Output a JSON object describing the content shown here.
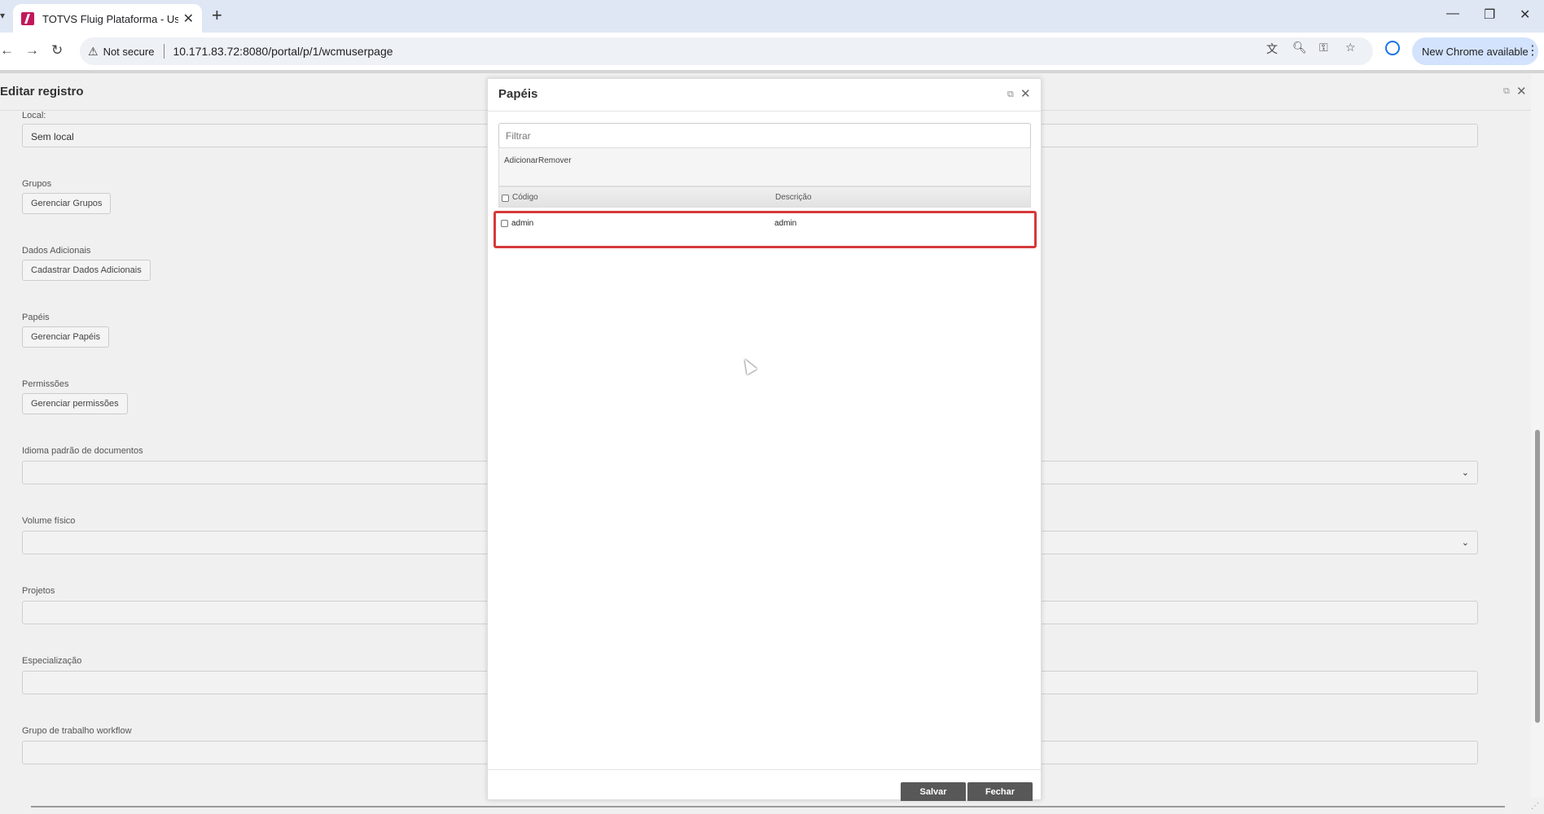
{
  "browser": {
    "tab_title": "TOTVS Fluig Plataforma - Usuár",
    "security_label": "Not secure",
    "url": "10.171.83.72:8080/portal/p/1/wcmuserpage",
    "update_label": "New Chrome available"
  },
  "page": {
    "title": "Editar registro",
    "fields": {
      "local_label": "Local:",
      "local_value": "Sem local",
      "grupos_label": "Grupos",
      "grupos_button": "Gerenciar Grupos",
      "dados_label": "Dados Adicionais",
      "dados_button": "Cadastrar Dados Adicionais",
      "papeis_label": "Papéis",
      "papeis_button": "Gerenciar Papéis",
      "permissoes_label": "Permissões",
      "permissoes_button": "Gerenciar permissões",
      "idioma_label": "Idioma padrão de documentos",
      "volume_label": "Volume físico",
      "projetos_label": "Projetos",
      "especializacao_label": "Especialização",
      "grupo_trabalho_label": "Grupo de trabalho workflow"
    }
  },
  "modal": {
    "title": "Papéis",
    "filter_placeholder": "Filtrar",
    "actions": {
      "add": "Adicionar",
      "remove": "Remover"
    },
    "columns": {
      "code": "Código",
      "description": "Descrição"
    },
    "rows": [
      {
        "code": "admin",
        "description": "admin",
        "checked": false
      }
    ],
    "buttons": {
      "save": "Salvar",
      "close": "Fechar"
    }
  },
  "colors": {
    "highlight": "#d63a3a",
    "button_dark": "#585858",
    "chrome_frame": "#dfe7f5"
  }
}
